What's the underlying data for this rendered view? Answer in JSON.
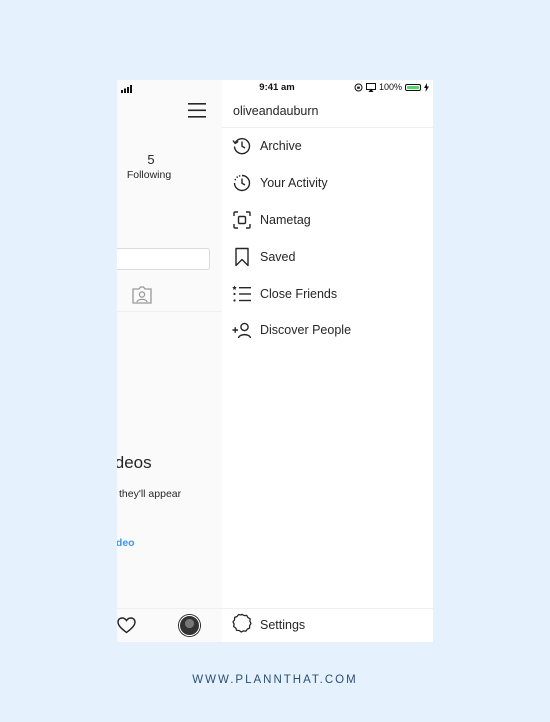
{
  "status_bar": {
    "time": "9:41 am",
    "battery": "100%"
  },
  "profile": {
    "following_count": "5",
    "following_label": "Following",
    "empty_title": "ideos",
    "empty_subtitle": "they'll appear",
    "empty_link": "ideo"
  },
  "menu": {
    "username": "oliveandauburn",
    "items": [
      {
        "label": "Archive",
        "icon": "archive-icon"
      },
      {
        "label": "Your Activity",
        "icon": "activity-icon"
      },
      {
        "label": "Nametag",
        "icon": "nametag-icon"
      },
      {
        "label": "Saved",
        "icon": "bookmark-icon"
      },
      {
        "label": "Close Friends",
        "icon": "close-friends-icon"
      },
      {
        "label": "Discover People",
        "icon": "discover-people-icon"
      }
    ],
    "settings_label": "Settings"
  },
  "footer": {
    "text": "WWW.PLANNTHAT.COM"
  },
  "colors": {
    "background": "#e5f2fd",
    "link": "#3897f0",
    "battery": "#4cd964",
    "footer": "#2c4f75"
  }
}
